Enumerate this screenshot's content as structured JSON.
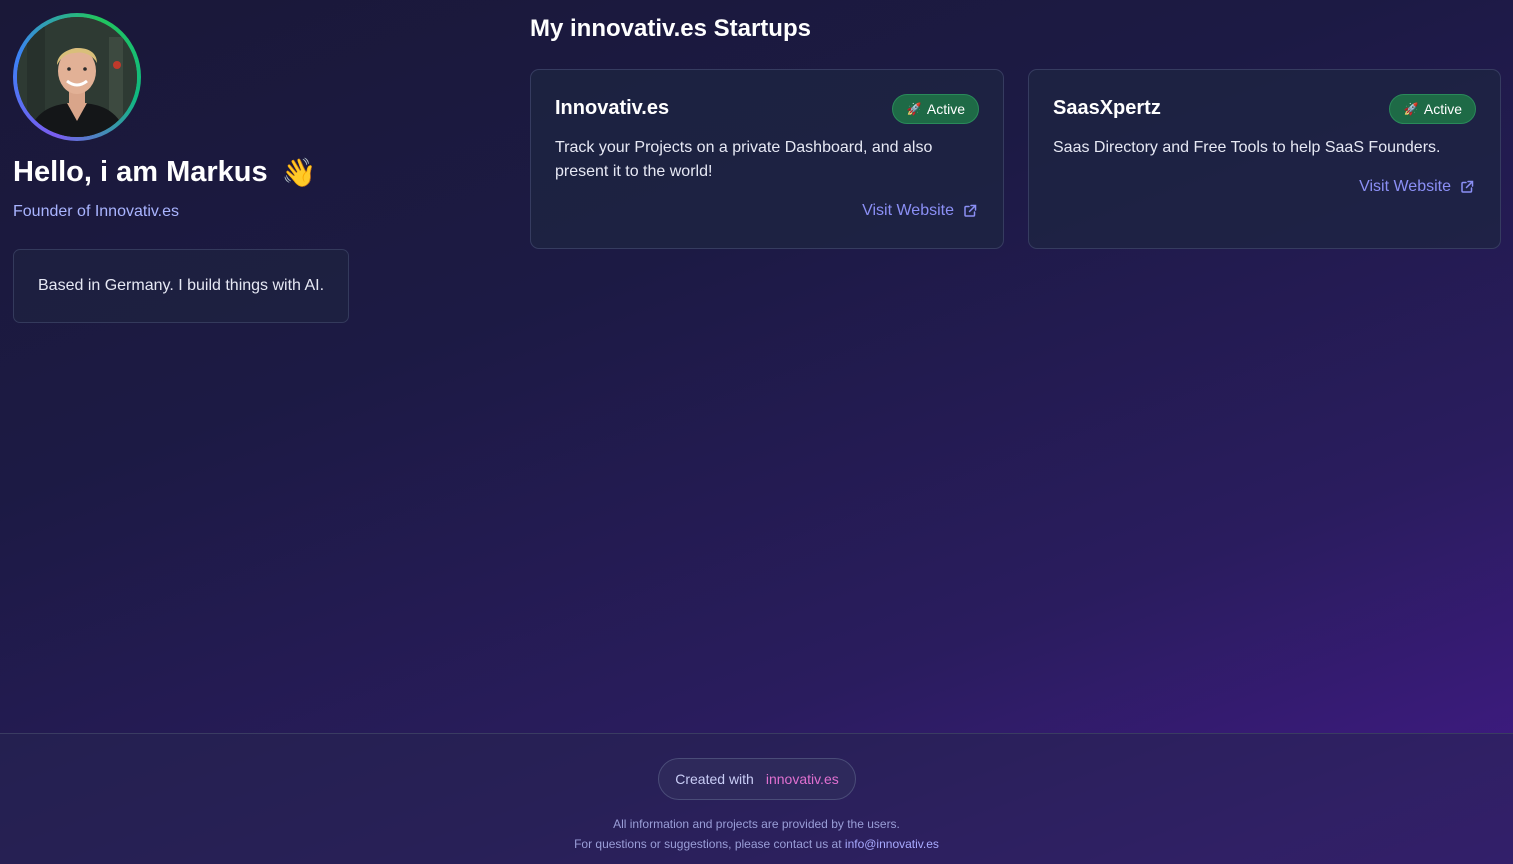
{
  "profile": {
    "greeting": "Hello, i am Markus",
    "wave_emoji": "👋",
    "subtitle": "Founder of Innovativ.es",
    "bio": "Based in Germany. I build things with AI."
  },
  "startups": {
    "section_title": "My innovativ.es Startups",
    "items": [
      {
        "name": "Innovativ.es",
        "status": "Active",
        "status_icon": "🚀",
        "description": "Track your Projects on a private Dashboard, and also present it to the world!",
        "link_label": "Visit Website"
      },
      {
        "name": "SaasXpertz",
        "status": "Active",
        "status_icon": "🚀",
        "description": "Saas Directory and Free Tools to help SaaS Founders.",
        "link_label": "Visit Website"
      }
    ]
  },
  "footer": {
    "created_with": "Created with",
    "brand": "innovativ.es",
    "disclaimer": "All information and projects are provided by the users.",
    "contact_prefix": "For questions or suggestions, please contact us at",
    "email": "info@innovativ.es"
  },
  "colors": {
    "accent": "#8b8ff5",
    "badge_green": "#1e6a46",
    "brand_pink": "#e070d0"
  },
  "icons": {
    "badge": "rocket-icon",
    "link": "external-link-icon",
    "wave": "waving-hand-icon"
  }
}
